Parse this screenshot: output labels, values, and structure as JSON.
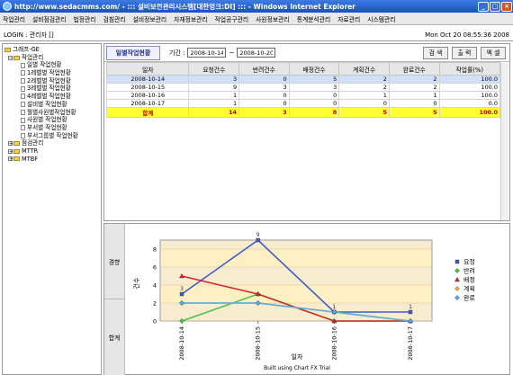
{
  "window": {
    "title": "http://www.sedacmms.com/ - ::: 설비보전관리시스템[대한엉크:DI] ::: - Windows Internet Explorer"
  },
  "menu": [
    "작업관리",
    "설비점검관리",
    "법정관리",
    "검침관리",
    "설비정보관리",
    "자재정보관리",
    "작업공구관리",
    "사원정보관리",
    "통계분석관리",
    "자료관리",
    "시스템관리"
  ],
  "login": {
    "label": "LOGIN : 관리자 []",
    "datetime": "Mon Oct 20 08:55:36 2008"
  },
  "tree": {
    "root": "그래프-GE",
    "group1": "작업관리",
    "items": [
      "일별 작업현황",
      "1레벨별 작업현황",
      "2레벨별 작업현황",
      "3레벨별 작업현황",
      "4레벨별 작업현황",
      "설비별 작업현황",
      "월별사원별작업현황",
      "사원별 작업현황",
      "부서별 작업현황",
      "부서그룹별 작업현황"
    ],
    "groups": [
      "점검관리",
      "MTTR",
      "MTBF"
    ]
  },
  "toolbar": {
    "tab": "일별작업현황",
    "period_label": "기간 :",
    "start": "2008-10-14",
    "tilde": "~",
    "end": "2008-10-20",
    "search": "검 색",
    "print": "출 력",
    "excel": "엑 셀"
  },
  "table": {
    "headers": [
      "일자",
      "요청건수",
      "반려건수",
      "배정건수",
      "계획건수",
      "완료건수",
      "작업률(%)"
    ],
    "rows": [
      [
        "2008-10-14",
        "3",
        "0",
        "5",
        "2",
        "2",
        "100.0"
      ],
      [
        "2008-10-15",
        "9",
        "3",
        "3",
        "2",
        "2",
        "100.0"
      ],
      [
        "2008-10-16",
        "1",
        "0",
        "0",
        "1",
        "1",
        "100.0"
      ],
      [
        "2008-10-17",
        "1",
        "0",
        "0",
        "0",
        "0",
        "0.0"
      ]
    ],
    "total": [
      "합계",
      "14",
      "3",
      "8",
      "5",
      "5",
      "100.0"
    ]
  },
  "chart_side": {
    "top": "경향",
    "bottom": "합계"
  },
  "colors": {
    "요청": "#3d5cc8",
    "반려": "#4cc24c",
    "배정": "#d42a2a",
    "계획": "#f0b13a",
    "완료": "#52aee0",
    "highlight": "#ffff33"
  },
  "chart_data": {
    "type": "line",
    "x": [
      "2008-10-14",
      "2008-10-15",
      "2008-10-16",
      "2008-10-17"
    ],
    "xlabel": "일자",
    "ylabel": "건수",
    "ylim": [
      0,
      9
    ],
    "yticks": [
      0,
      2,
      4,
      6,
      8
    ],
    "series": [
      {
        "name": "요청",
        "values": [
          3,
          9,
          1,
          1
        ]
      },
      {
        "name": "반려",
        "values": [
          0,
          3,
          0,
          0
        ]
      },
      {
        "name": "배정",
        "values": [
          5,
          3,
          0,
          0
        ]
      },
      {
        "name": "계획",
        "values": [
          2,
          2,
          1,
          0
        ]
      },
      {
        "name": "완료",
        "values": [
          2,
          2,
          1,
          0
        ]
      }
    ],
    "footer": "Built using Chart FX Trial",
    "legend": "right",
    "grid": true
  }
}
